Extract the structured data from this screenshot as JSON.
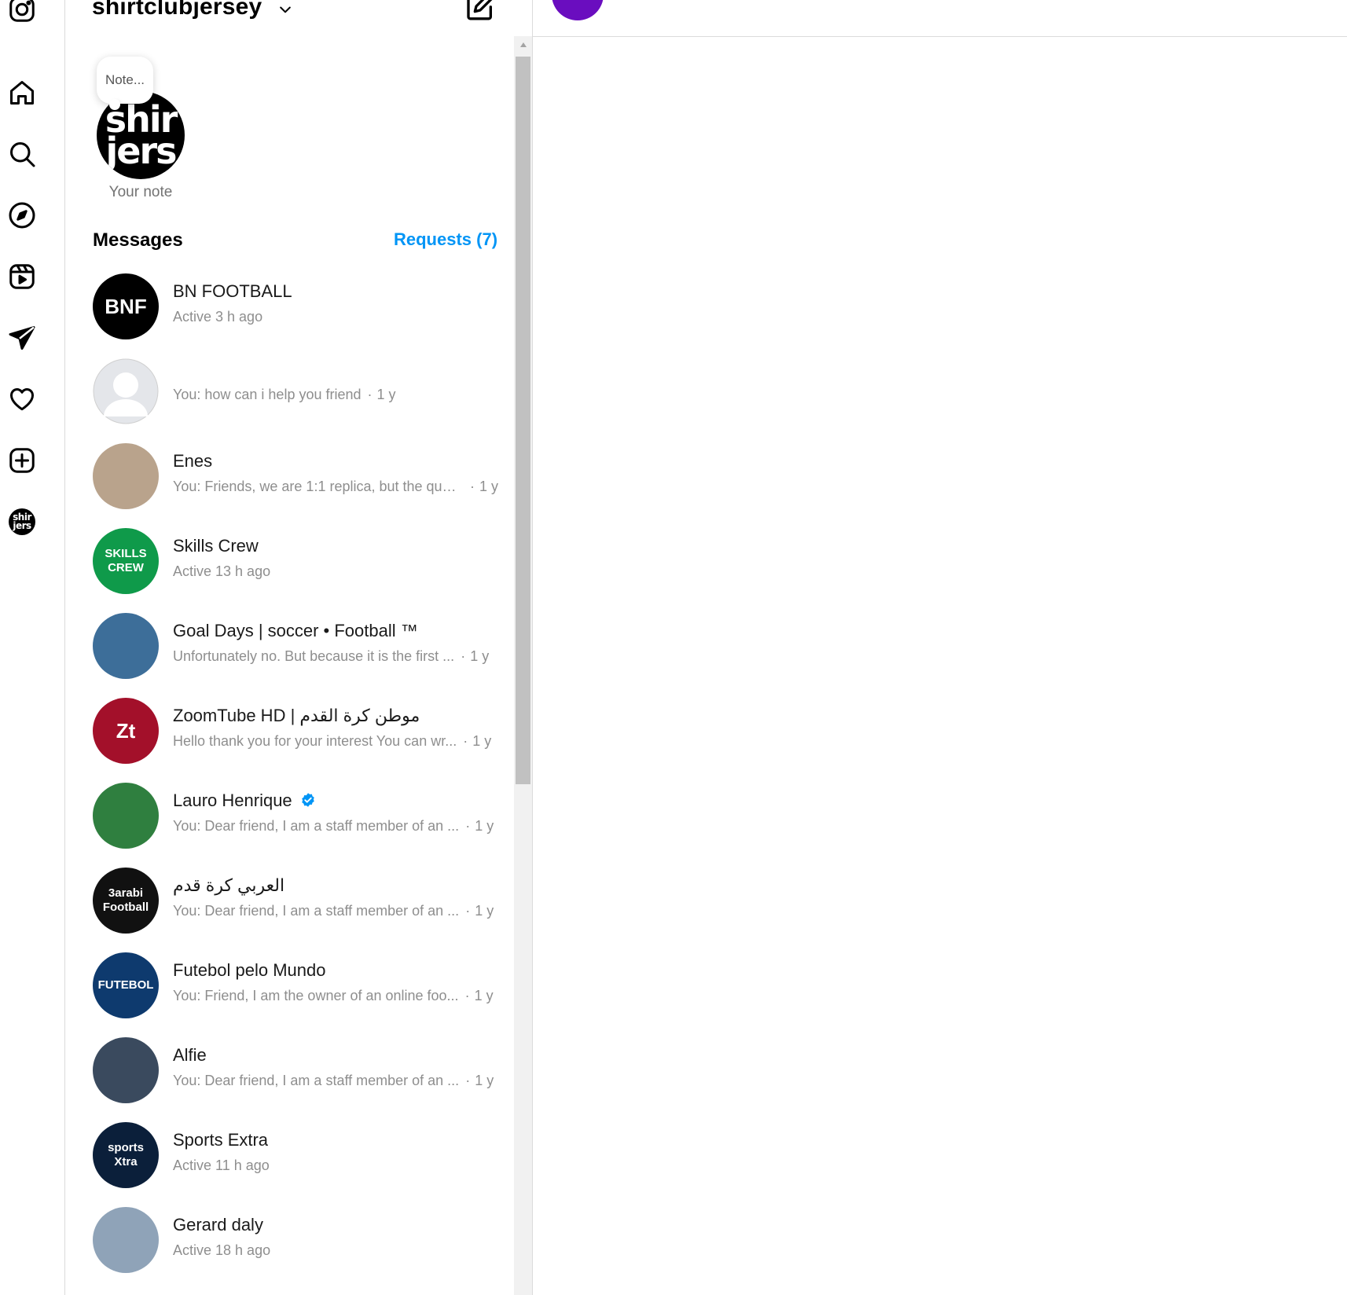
{
  "account": {
    "username": "shirtclubjersey"
  },
  "note": {
    "bubble_text": "Note...",
    "caption": "Your note",
    "avatar_text_line1": "shir",
    "avatar_text_line2": "jers"
  },
  "inbox": {
    "title": "Messages",
    "requests_label": "Requests (7)"
  },
  "rail": {
    "items": [
      "instagram-logo-icon",
      "home-icon",
      "search-icon",
      "explore-icon",
      "reels-icon",
      "messages-icon",
      "notifications-icon",
      "create-icon",
      "profile-avatar"
    ]
  },
  "conversations": [
    {
      "name": "BN FOOTBALL",
      "preview": "Active 3 h ago",
      "time": "",
      "avatar_text": "BNF",
      "avatar_color": "#000000"
    },
    {
      "name": "",
      "preview": "You: how can i help you friend",
      "time": "1 y",
      "avatar_text": "",
      "avatar_color": "#dbdbdb"
    },
    {
      "name": "Enes",
      "preview": "You: Friends, we are 1:1 replica, but the quali...",
      "time": "1 y",
      "avatar_text": "",
      "avatar_color": "#b9a38c"
    },
    {
      "name": "Skills Crew",
      "preview": "Active 13 h ago",
      "time": "",
      "avatar_text": "SKILLS CREW",
      "avatar_color": "#0f9a4a"
    },
    {
      "name": "Goal Days | soccer • Football ™",
      "preview": "Unfortunately no. But because it is the first ...",
      "time": "1 y",
      "avatar_text": "",
      "avatar_color": "#3d6e99"
    },
    {
      "name": "ZoomTube HD | موطن كرة القدم",
      "preview": "Hello thank you for your interest You can wr...",
      "time": "1 y",
      "avatar_text": "Zt",
      "avatar_color": "#a3102a"
    },
    {
      "name": "Lauro Henrique",
      "preview": "You: Dear friend, I am a staff member of an ...",
      "time": "1 y",
      "avatar_text": "",
      "avatar_color": "#2f7f3f",
      "verified": true
    },
    {
      "name": "العربي كرة قدم",
      "preview": "You: Dear friend, I am a staff member of an ...",
      "time": "1 y",
      "avatar_text": "3arabi Football",
      "avatar_color": "#111111"
    },
    {
      "name": "Futebol pelo Mundo",
      "preview": "You: Friend, I am the owner of an online foo...",
      "time": "1 y",
      "avatar_text": "FUTEBOL",
      "avatar_color": "#0e3a6e"
    },
    {
      "name": "Alfie",
      "preview": "You: Dear friend, I am a staff member of an ...",
      "time": "1 y",
      "avatar_text": "",
      "avatar_color": "#3a4a5e"
    },
    {
      "name": "Sports Extra",
      "preview": "Active 11 h ago",
      "time": "",
      "avatar_text": "sports Xtra",
      "avatar_color": "#0b1f3a"
    },
    {
      "name": "Gerard daly",
      "preview": "Active 18 h ago",
      "time": "",
      "avatar_text": "",
      "avatar_color": "#8fa3b8"
    }
  ],
  "colors": {
    "accent": "#0095f6",
    "muted": "#8e8e8e",
    "border": "#dbdbdb",
    "thread_avatar": "#6a0dbf"
  }
}
